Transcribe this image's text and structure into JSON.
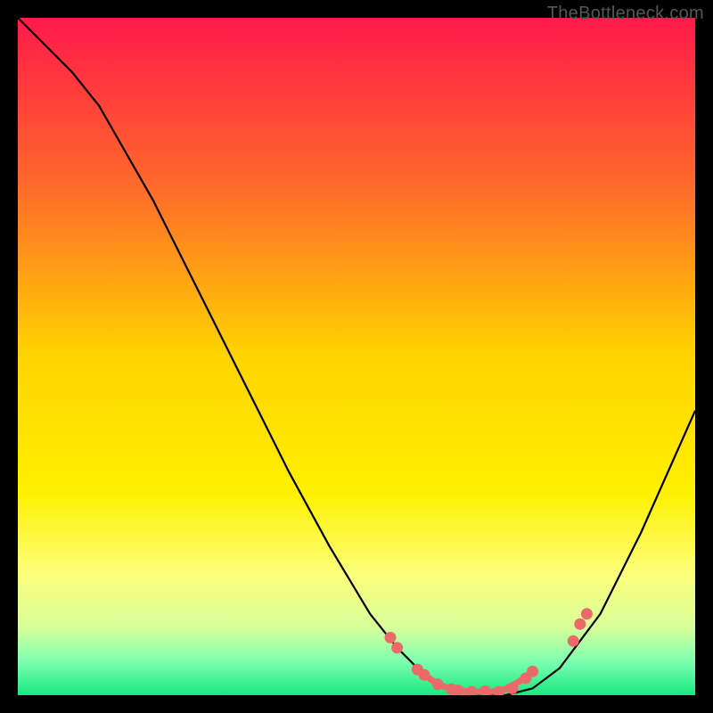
{
  "watermark": "TheBottleneck.com",
  "chart_data": {
    "type": "line",
    "title": "",
    "xlabel": "",
    "ylabel": "",
    "xlim": [
      0,
      100
    ],
    "ylim": [
      0,
      100
    ],
    "gradient_stops": [
      {
        "offset": 0,
        "color": "#ff1a4a"
      },
      {
        "offset": 25,
        "color": "#ff6a2a"
      },
      {
        "offset": 50,
        "color": "#ffd400"
      },
      {
        "offset": 70,
        "color": "#fff000"
      },
      {
        "offset": 82,
        "color": "#fcff7a"
      },
      {
        "offset": 90,
        "color": "#d8ff9a"
      },
      {
        "offset": 95,
        "color": "#7dffb0"
      },
      {
        "offset": 100,
        "color": "#18e880"
      }
    ],
    "series": [
      {
        "name": "bottleneck-curve",
        "x": [
          0,
          4,
          8,
          12,
          16,
          20,
          24,
          28,
          32,
          36,
          40,
          46,
          52,
          56,
          60,
          64,
          68,
          72,
          76,
          80,
          86,
          92,
          100
        ],
        "y": [
          100,
          96,
          92,
          87,
          80,
          73,
          65,
          57,
          49,
          41,
          33,
          22,
          12,
          7,
          3,
          1,
          0,
          0,
          1,
          4,
          12,
          24,
          42
        ]
      }
    ],
    "highlight_points": {
      "name": "sample-dots",
      "color": "#ea6a6a",
      "xy": [
        [
          55,
          8.5
        ],
        [
          56,
          7.0
        ],
        [
          59,
          3.8
        ],
        [
          60,
          3.0
        ],
        [
          62,
          1.6
        ],
        [
          64,
          0.9
        ],
        [
          65,
          0.7
        ],
        [
          67,
          0.5
        ],
        [
          69,
          0.6
        ],
        [
          71,
          0.5
        ],
        [
          73,
          1.0
        ],
        [
          75,
          2.5
        ],
        [
          76,
          3.5
        ],
        [
          82,
          8.0
        ],
        [
          83,
          10.5
        ],
        [
          84,
          12.0
        ]
      ]
    },
    "highlight_path_segment": {
      "color": "#ea6a6a",
      "x": [
        60,
        62,
        64,
        66,
        68,
        70,
        72,
        74,
        76
      ],
      "y": [
        3.0,
        1.6,
        0.9,
        0.6,
        0.5,
        0.5,
        0.9,
        2.0,
        3.5
      ]
    }
  }
}
